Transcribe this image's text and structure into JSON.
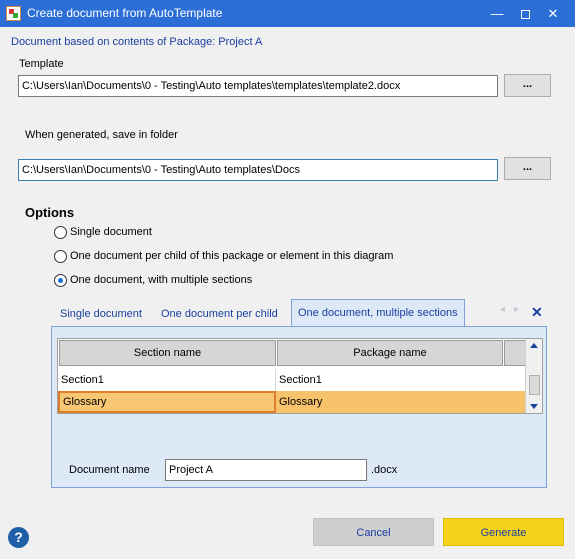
{
  "window": {
    "title": "Create document from AutoTemplate",
    "app_icon": "autotemplate-app-icon",
    "controls": {
      "minimize": "—",
      "close": "✕"
    }
  },
  "heading": "Document based on contents of Package: Project A",
  "template": {
    "label": "Template",
    "value": "C:\\Users\\Ian\\Documents\\0 - Testing\\Auto templates\\templates\\template2.docx",
    "browse_label": "..."
  },
  "save_folder": {
    "label": "When generated, save in folder",
    "value": "C:\\Users\\Ian\\Documents\\0 - Testing\\Auto templates\\Docs",
    "browse_label": "..."
  },
  "options": {
    "title": "Options",
    "radios": [
      {
        "label": "Single document",
        "checked": false
      },
      {
        "label": "One document per child of this package or element in this diagram",
        "checked": false
      },
      {
        "label": "One document, with multiple sections",
        "checked": true
      }
    ]
  },
  "tabs": {
    "items": [
      {
        "label": "Single document",
        "active": false
      },
      {
        "label": "One document per child",
        "active": false
      },
      {
        "label": "One document, multiple sections",
        "active": true
      }
    ],
    "prev": "◂",
    "next": "▸",
    "close": "✕"
  },
  "grid": {
    "columns": [
      "Section name",
      "Package name"
    ],
    "rows": [
      {
        "section": "Section1",
        "package": "Section1",
        "selected": false
      },
      {
        "section": "Glossary",
        "package": "Glossary",
        "selected": true
      }
    ]
  },
  "document_name": {
    "label": "Document name",
    "value": "Project A",
    "suffix": ".docx"
  },
  "buttons": {
    "cancel": "Cancel",
    "generate": "Generate",
    "help": "?"
  },
  "colors": {
    "titlebar": "#2b6fd6",
    "link_text": "#1a3fa0",
    "selected_row": "#f7c36a",
    "generate": "#f5d31a"
  }
}
